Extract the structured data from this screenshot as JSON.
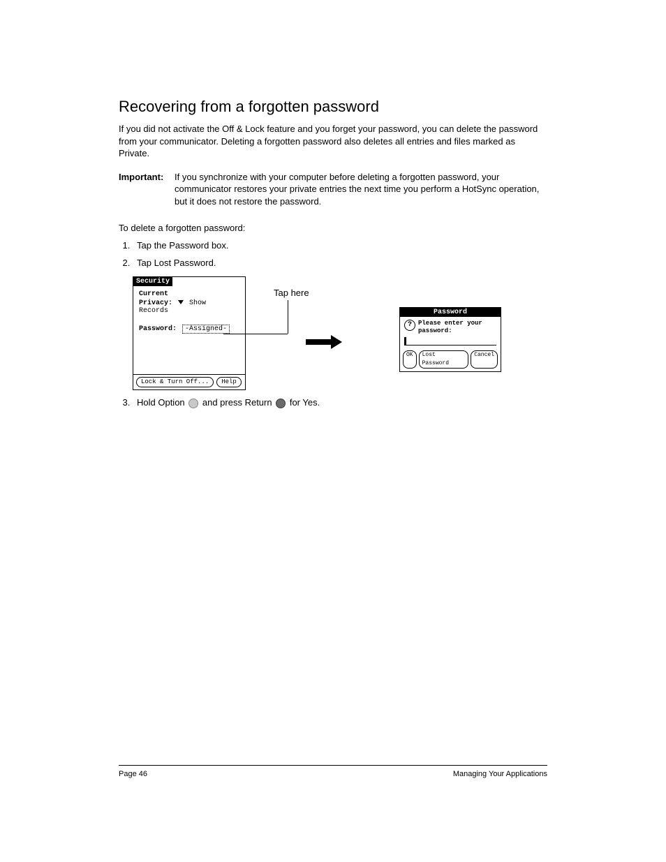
{
  "title": "Recovering from a forgotten password",
  "intro": "If you did not activate the Off & Lock feature and you forget your password, you can delete the password from your communicator. Deleting a forgotten password also deletes all entries and files marked as Private.",
  "important": {
    "label": "Important:",
    "text": "If you synchronize with your computer before deleting a forgotten password, your communicator restores your private entries the next time you perform a HotSync operation, but it does not restore the password."
  },
  "subhead": "To delete a forgotten password:",
  "steps12": [
    "Tap the Password box.",
    "Tap Lost Password."
  ],
  "callout": "Tap here",
  "security_panel": {
    "title": "Security",
    "current": "Current",
    "privacy_label": "Privacy:",
    "privacy_value": "Show Records",
    "password_label": "Password:",
    "password_value": "-Assigned-",
    "lock_btn": "Lock & Turn Off...",
    "help_btn": "Help"
  },
  "password_dialog": {
    "title": "Password",
    "prompt": "Please enter your password:",
    "ok": "OK",
    "lost": "Lost Password",
    "cancel": "Cancel"
  },
  "step3": {
    "pre": "Hold Option ",
    "mid": " and press Return ",
    "post": " for Yes."
  },
  "footer": {
    "left": "Page 46",
    "right": "Managing Your Applications"
  }
}
